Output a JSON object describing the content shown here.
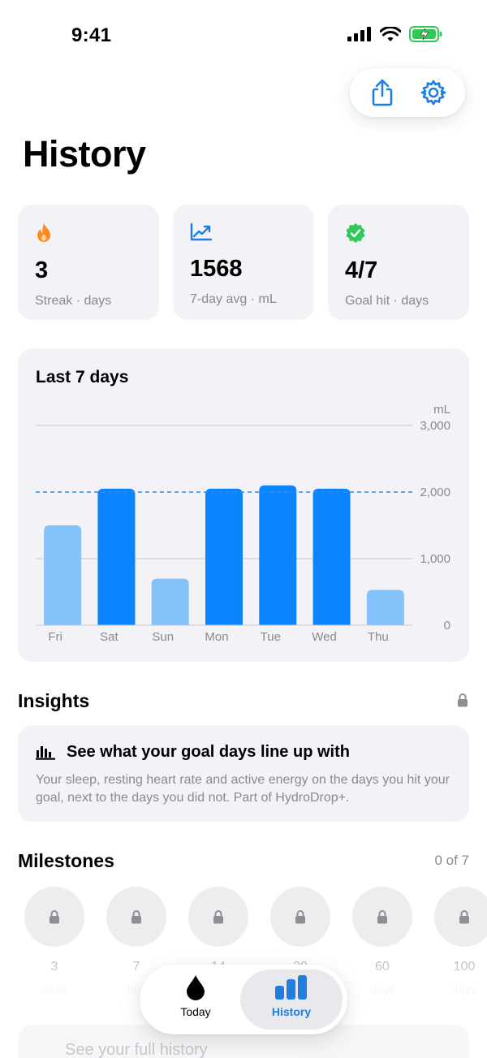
{
  "status_bar": {
    "time": "9:41"
  },
  "page": {
    "title": "History"
  },
  "stats": [
    {
      "value": "3",
      "label": "Streak · days",
      "icon": "flame-icon",
      "color": "#ff8a1f"
    },
    {
      "value": "1568",
      "label": "7-day avg · mL",
      "icon": "trend-up-icon",
      "color": "#1e7fe0"
    },
    {
      "value": "4/7",
      "label": "Goal hit · days",
      "icon": "check-badge-icon",
      "color": "#34c759"
    }
  ],
  "chart_data": {
    "type": "bar",
    "title": "Last 7 days",
    "ylabel": "mL",
    "categories": [
      "Fri",
      "Sat",
      "Sun",
      "Mon",
      "Tue",
      "Wed",
      "Thu"
    ],
    "values": [
      1500,
      2050,
      700,
      2050,
      2100,
      2050,
      530
    ],
    "goal_met": [
      false,
      true,
      false,
      true,
      true,
      true,
      false
    ],
    "goal_line": 2000,
    "ylim": [
      0,
      3000
    ],
    "yticks": [
      0,
      1000,
      2000,
      3000
    ],
    "ytick_labels": [
      "0",
      "1,000",
      "2,000",
      "3,000"
    ],
    "colors": {
      "met": "#0a84ff",
      "not_met": "#84c2fb",
      "goal": "#2f8ee6",
      "grid": "#c9c9ce"
    }
  },
  "insights": {
    "title": "Insights",
    "card_title": "See what your goal days line up with",
    "card_body": "Your sleep, resting heart rate and active energy on the days you hit your goal, next to the days you did not. Part of HydroDrop+."
  },
  "milestones": {
    "title": "Milestones",
    "count": "0 of 7",
    "items": [
      {
        "num": "3",
        "unit": "days"
      },
      {
        "num": "7",
        "unit": "days"
      },
      {
        "num": "14",
        "unit": "days"
      },
      {
        "num": "30",
        "unit": "days"
      },
      {
        "num": "60",
        "unit": "days"
      },
      {
        "num": "100",
        "unit": "days"
      }
    ]
  },
  "cta": {
    "label": "See your full history"
  },
  "tabs": [
    {
      "label": "Today",
      "icon": "drop-icon",
      "active": false
    },
    {
      "label": "History",
      "icon": "bar-chart-icon",
      "active": true
    }
  ]
}
